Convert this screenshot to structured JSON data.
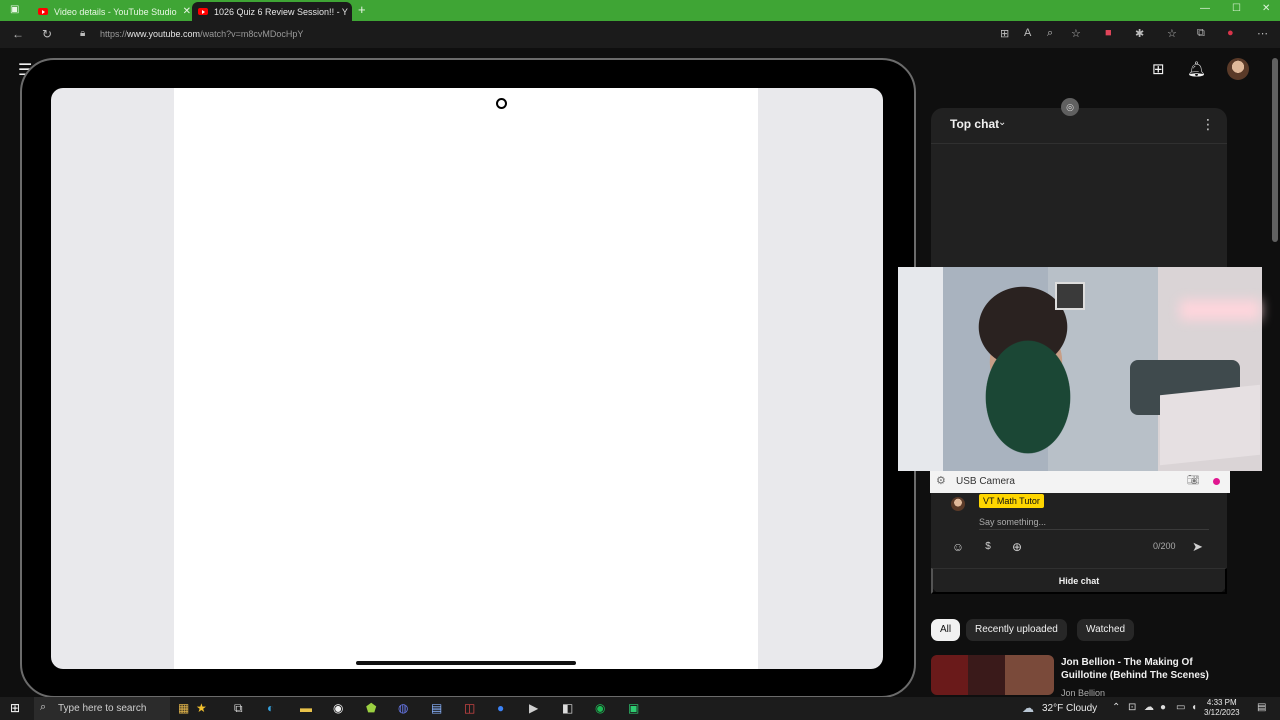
{
  "browser": {
    "tabs": [
      {
        "label": "Video details - YouTube Studio",
        "active": false
      },
      {
        "label": "1026 Quiz 6 Review Session!! - Y",
        "active": true
      }
    ],
    "url_prefix": "https://",
    "url_domain": "www.youtube.com",
    "url_path": "/watch?v=m8cvMDocHpY"
  },
  "chat": {
    "header_label": "Top chat",
    "author_name": "VT Math Tutor",
    "input_placeholder": "Say something...",
    "char_count": "0/200",
    "hide_label": "Hide chat"
  },
  "webcam": {
    "source_label": "USB Camera"
  },
  "filters": {
    "chips": [
      "All",
      "Recently uploaded",
      "Watched"
    ],
    "selected_index": 0
  },
  "recommended": [
    {
      "title": "Jon Bellion - The Making Of Guillotine (Behind The Scenes)",
      "channel": "Jon Bellion"
    }
  ],
  "taskbar": {
    "search_placeholder": "Type here to search",
    "weather": "32°F  Cloudy",
    "time": "4:33 PM",
    "date": "3/12/2023"
  },
  "colors": {
    "tab_strip": "#3fa535",
    "author_chip": "#ffd600",
    "record_dot": "#e0168f"
  }
}
